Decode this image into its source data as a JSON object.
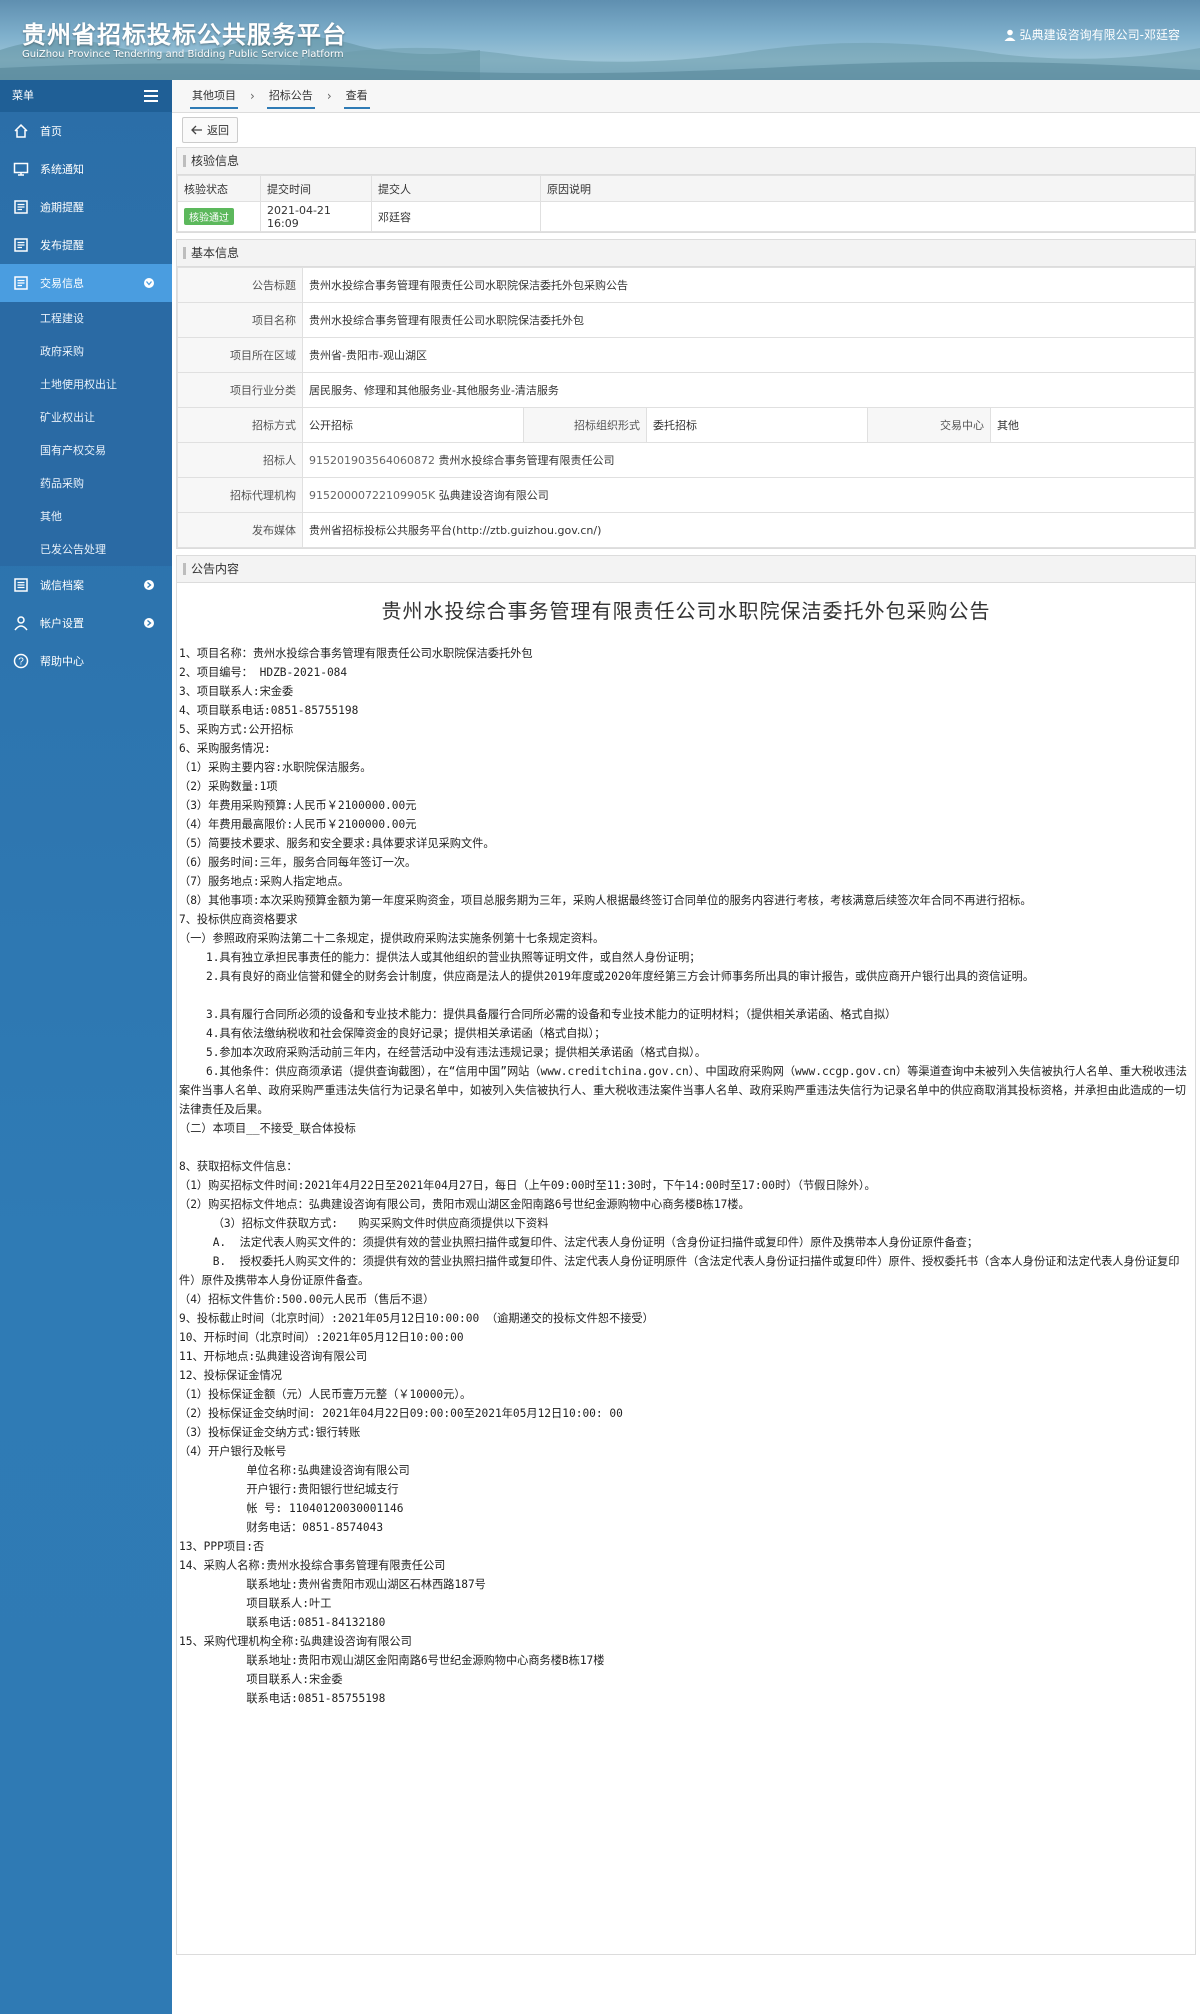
{
  "header": {
    "title": "贵州省招标投标公共服务平台",
    "subtitle": "GuiZhou Province Tendering and Bidding Public Service Platform",
    "user": "弘典建设咨询有限公司-邓廷容",
    "user_icon": "user-icon"
  },
  "sidebar": {
    "menu_label": "菜单",
    "items": [
      {
        "label": "首页",
        "icon": "home-icon"
      },
      {
        "label": "系统通知",
        "icon": "monitor-icon"
      },
      {
        "label": "逾期提醒",
        "icon": "document-icon"
      },
      {
        "label": "发布提醒",
        "icon": "document-icon"
      },
      {
        "label": "交易信息",
        "icon": "document-icon"
      }
    ],
    "sub_items": [
      "工程建设",
      "政府采购",
      "土地使用权出让",
      "矿业权出让",
      "国有产权交易",
      "药品采购",
      "其他",
      "已发公告处理"
    ],
    "bottom_items": [
      {
        "label": "诚信档案",
        "icon": "list-icon"
      },
      {
        "label": "帐户设置",
        "icon": "user-icon"
      },
      {
        "label": "帮助中心",
        "icon": "help-icon"
      }
    ]
  },
  "breadcrumb": [
    "其他项目",
    "招标公告",
    "查看"
  ],
  "toolbar": {
    "back": "返回"
  },
  "verify": {
    "title": "核验信息",
    "headers": [
      "核验状态",
      "提交时间",
      "提交人",
      "原因说明"
    ],
    "status": "核验通过",
    "time": "2021-04-21 16:09",
    "submitter": "邓廷容",
    "reason": ""
  },
  "basic": {
    "title": "基本信息",
    "rows": [
      {
        "label": "公告标题",
        "value": "贵州水投综合事务管理有限责任公司水职院保洁委托外包采购公告"
      },
      {
        "label": "项目名称",
        "value": "贵州水投综合事务管理有限责任公司水职院保洁委托外包"
      },
      {
        "label": "项目所在区域",
        "value": "贵州省-贵阳市-观山湖区"
      },
      {
        "label": "项目行业分类",
        "value": "居民服务、修理和其他服务业-其他服务业-清洁服务"
      }
    ],
    "method_label": "招标方式",
    "method": "公开招标",
    "org_form_label": "招标组织形式",
    "org_form": "委托招标",
    "center_label": "交易中心",
    "center": "其他",
    "tenderer_label": "招标人",
    "tenderer_code": "915201903564060872",
    "tenderer": "贵州水投综合事务管理有限责任公司",
    "agency_label": "招标代理机构",
    "agency_code": "91520000722109905K",
    "agency": "弘典建设咨询有限公司",
    "media_label": "发布媒体",
    "media": "贵州省招标投标公共服务平台(http://ztb.guizhou.gov.cn/)"
  },
  "content": {
    "title": "公告内容",
    "doc_title": "贵州水投综合事务管理有限责任公司水职院保洁委托外包采购公告",
    "lines": [
      "1、项目名称：贵州水投综合事务管理有限责任公司水职院保洁委托外包",
      "2、项目编号： HDZB-2021-084",
      "3、项目联系人:宋金委",
      "4、项目联系电话:0851-85755198",
      "5、采购方式:公开招标",
      "6、采购服务情况:",
      "（1）采购主要内容:水职院保洁服务。",
      "（2）采购数量:1项",
      "（3）年费用采购预算:人民币￥2100000.00元",
      "（4）年费用最高限价:人民币￥2100000.00元",
      "（5）简要技术要求、服务和安全要求:具体要求详见采购文件。",
      "（6）服务时间:三年，服务合同每年签订一次。",
      "（7）服务地点:采购人指定地点。",
      "（8）其他事项:本次采购预算金额为第一年度采购资金，项目总服务期为三年，采购人根据最终签订合同单位的服务内容进行考核，考核满意后续签次年合同不再进行招标。",
      "7、投标供应商资格要求",
      "（一）参照政府采购法第二十二条规定，提供政府采购法实施条例第十七条规定资料。",
      "    1.具有独立承担民事责任的能力：提供法人或其他组织的营业执照等证明文件，或自然人身份证明；",
      "    2.具有良好的商业信誉和健全的财务会计制度，供应商是法人的提供2019年度或2020年度经第三方会计师事务所出具的审计报告，或供应商开户银行出具的资信证明。",
      "",
      "    3.具有履行合同所必须的设备和专业技术能力：提供具备履行合同所必需的设备和专业技术能力的证明材料；（提供相关承诺函、格式自拟）",
      "    4.具有依法缴纳税收和社会保障资金的良好记录；提供相关承诺函（格式自拟）；",
      "    5.参加本次政府采购活动前三年内，在经营活动中没有违法违规记录；提供相关承诺函（格式自拟）。",
      "    6.其他条件：供应商须承诺（提供查询截图），在“信用中国”网站（www.creditchina.gov.cn）、中国政府采购网（www.ccgp.gov.cn）等渠道查询中未被列入失信被执行人名单、重大税收违法案件当事人名单、政府采购严重违法失信行为记录名单中，如被列入失信被执行人、重大税收违法案件当事人名单、政府采购严重违法失信行为记录名单中的供应商取消其投标资格，并承担由此造成的一切法律责任及后果。",
      "（二）本项目__不接受_联合体投标",
      "",
      "8、获取招标文件信息：",
      "（1）购买招标文件时间:2021年4月22日至2021年04月27日，每日（上午09:00时至11:30时，下午14:00时至17:00时）（节假日除外）。",
      "（2）购买招标文件地点：弘典建设咨询有限公司，贵阳市观山湖区金阳南路6号世纪金源购物中心商务楼B栋17楼。",
      "     （3）招标文件获取方式:   购买采购文件时供应商须提供以下资料",
      "     A.  法定代表人购买文件的：须提供有效的营业执照扫描件或复印件、法定代表人身份证明（含身份证扫描件或复印件）原件及携带本人身份证原件备查；",
      "     B.  授权委托人购买文件的：须提供有效的营业执照扫描件或复印件、法定代表人身份证明原件（含法定代表人身份证扫描件或复印件）原件、授权委托书（含本人身份证和法定代表人身份证复印件）原件及携带本人身份证原件备查。",
      "（4）招标文件售价:500.00元人民币（售后不退）",
      "9、投标截止时间（北京时间）:2021年05月12日10:00:00 （逾期递交的投标文件恕不接受）",
      "10、开标时间（北京时间）:2021年05月12日10:00:00",
      "11、开标地点:弘典建设咨询有限公司",
      "12、投标保证金情况",
      "（1）投标保证金额（元）人民币壹万元整（￥10000元）。",
      "（2）投标保证金交纳时间: 2021年04月22日09:00:00至2021年05月12日10:00: 00",
      "（3）投标保证金交纳方式:银行转账",
      "（4）开户银行及帐号",
      "          单位名称:弘典建设咨询有限公司",
      "          开户银行:贵阳银行世纪城支行",
      "          帐 号: 11040120030001146",
      "          财务电话：0851-8574043",
      "13、PPP项目:否",
      "14、采购人名称:贵州水投综合事务管理有限责任公司",
      "          联系地址:贵州省贵阳市观山湖区石林西路187号",
      "          项目联系人:叶工",
      "          联系电话:0851-84132180",
      "15、采购代理机构全称:弘典建设咨询有限公司",
      "          联系地址:贵阳市观山湖区金阳南路6号世纪金源购物中心商务楼B栋17楼",
      "          项目联系人:宋金委",
      "          联系电话:0851-85755198"
    ]
  }
}
